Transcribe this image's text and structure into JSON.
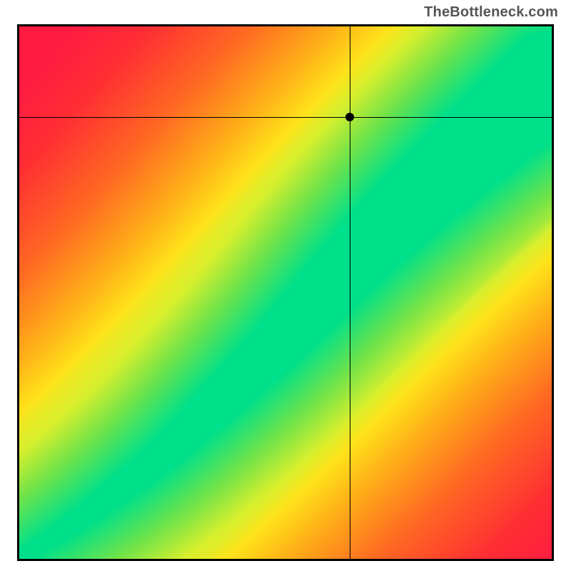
{
  "watermark": "TheBottleneck.com",
  "chart_data": {
    "type": "heatmap",
    "title": "",
    "xlabel": "",
    "ylabel": "",
    "xlim": [
      0,
      100
    ],
    "ylim": [
      0,
      100
    ],
    "axes_visible": false,
    "grid": false,
    "legend": false,
    "crosshair": {
      "x": 62,
      "y": 83
    },
    "optimal_band": {
      "description": "curved diagonal band of low bottleneck",
      "center_curve_points": [
        {
          "x": 0,
          "y": 0
        },
        {
          "x": 12,
          "y": 8
        },
        {
          "x": 25,
          "y": 18
        },
        {
          "x": 38,
          "y": 30
        },
        {
          "x": 50,
          "y": 42
        },
        {
          "x": 62,
          "y": 55
        },
        {
          "x": 74,
          "y": 67
        },
        {
          "x": 86,
          "y": 78
        },
        {
          "x": 100,
          "y": 90
        }
      ],
      "band_width_fraction_start": 0.02,
      "band_width_fraction_end": 0.18
    },
    "color_scale": {
      "stops": [
        {
          "d": 0.0,
          "color": "#00e08a"
        },
        {
          "d": 0.08,
          "color": "#6fe34a"
        },
        {
          "d": 0.15,
          "color": "#d7ef2e"
        },
        {
          "d": 0.22,
          "color": "#ffe31a"
        },
        {
          "d": 0.35,
          "color": "#ffb018"
        },
        {
          "d": 0.55,
          "color": "#ff6a22"
        },
        {
          "d": 0.8,
          "color": "#ff2d34"
        },
        {
          "d": 1.0,
          "color": "#ff1a42"
        }
      ]
    }
  }
}
